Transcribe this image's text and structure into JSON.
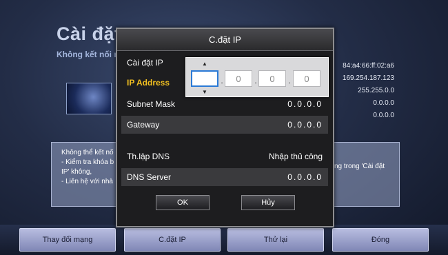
{
  "background": {
    "title": "Cài đặt m",
    "subtitle": "Không kết nối m",
    "info_values": [
      "84:a4:66:ff:02:a6",
      "169.254.187.123",
      "255.255.0.0",
      "0.0.0.0",
      "0.0.0.0"
    ],
    "message_left_lines": [
      "Không thể kết nố",
      "- Kiểm tra khóa b",
      "IP' không,",
      "- Liên hệ với nhà"
    ],
    "message_right_lines": [
      "ng trong 'Cài đặt"
    ]
  },
  "bottom_buttons": [
    {
      "label": "Thay đổi mạng"
    },
    {
      "label": "C.đặt IP"
    },
    {
      "label": "Thử lại"
    },
    {
      "label": "Đóng"
    }
  ],
  "dialog": {
    "title": "C.đặt IP",
    "ip_setting_label": "Cài đặt IP",
    "ip_address_label": "IP Address",
    "subnet_label": "Subnet Mask",
    "subnet_value": "0.0.0.0",
    "gateway_label": "Gateway",
    "gateway_value": "0.0.0.0",
    "dns_setting_label": "Th.lập DNS",
    "dns_setting_value": "Nhập thủ công",
    "dns_server_label": "DNS Server",
    "dns_server_value": "0.0.0.0",
    "ok_label": "OK",
    "cancel_label": "Hủy"
  },
  "ip_editor": {
    "octets": [
      "",
      "0",
      "0",
      "0"
    ],
    "active_index": 0,
    "up_arrow": "▲",
    "down_arrow": "▼"
  },
  "colors": {
    "highlight": "#f2c020",
    "active_field_border": "#2a7ad6"
  }
}
